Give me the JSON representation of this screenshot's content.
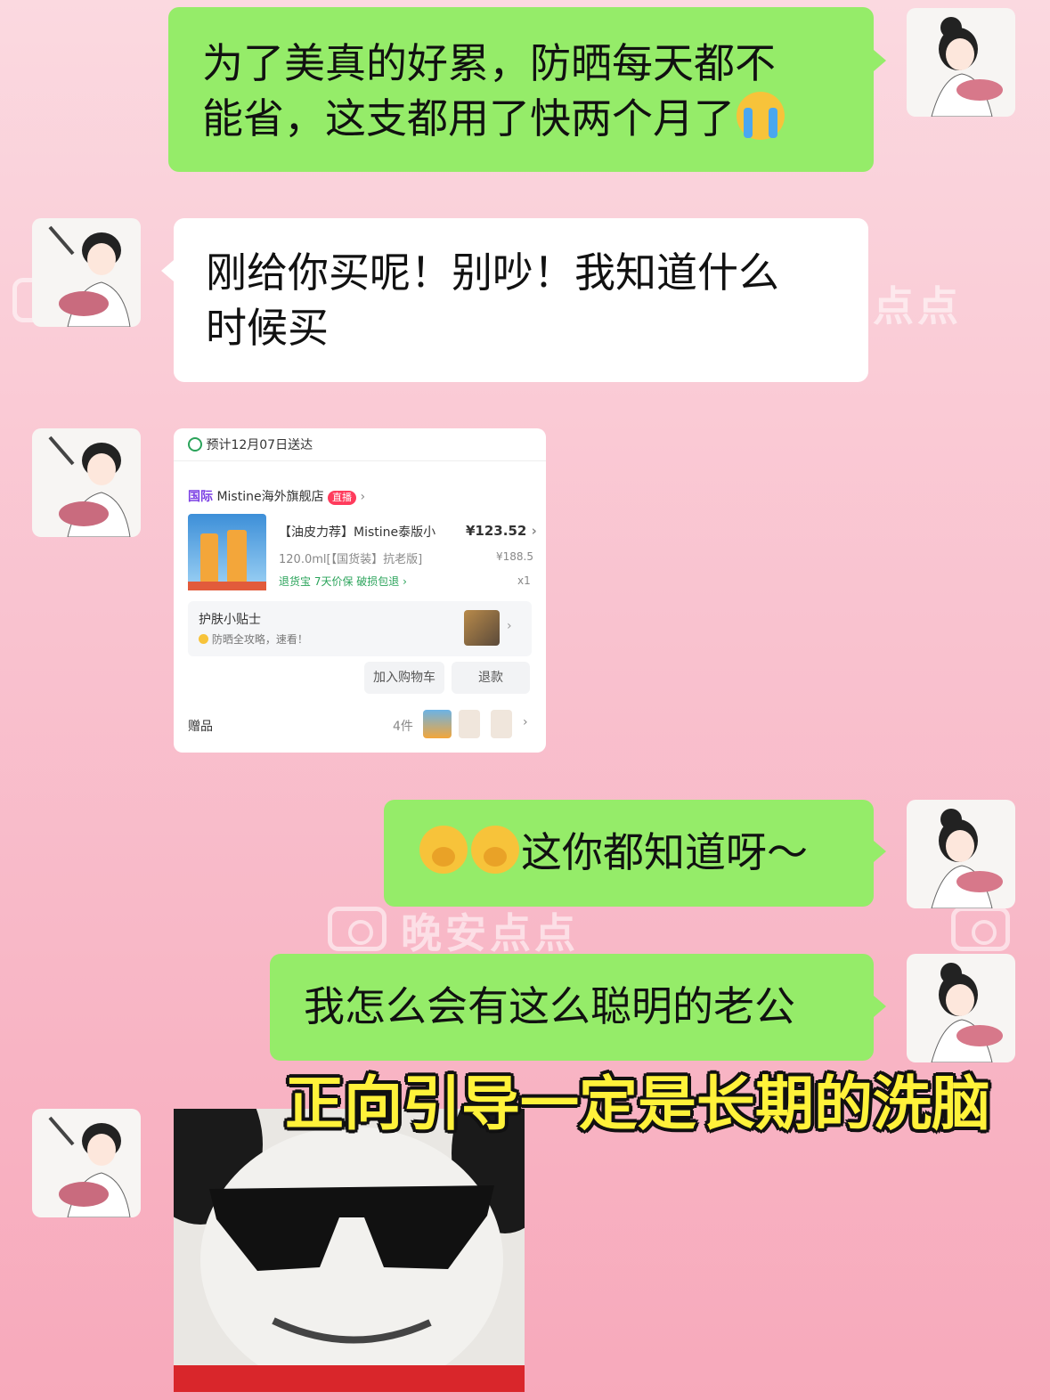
{
  "watermark": {
    "text": "晚安点点"
  },
  "messages": [
    {
      "side": "right",
      "bubble": "green",
      "lines": [
        "为了美真的好累，防晒每天都不",
        "能省，这支都用了快两个月了"
      ],
      "emoji": "crying-face"
    },
    {
      "side": "left",
      "bubble": "white",
      "lines": [
        "刚给你买呢！别吵！我知道什么",
        "时候买"
      ]
    },
    {
      "side": "left",
      "type": "order-card"
    },
    {
      "side": "right",
      "bubble": "green",
      "text": "这你都知道呀～",
      "emoji": "shushing-face"
    },
    {
      "side": "right",
      "bubble": "green",
      "text": "我怎么会有这么聪明的老公"
    },
    {
      "side": "left",
      "type": "sticker",
      "sticker": "panda-sunglasses-meme"
    }
  ],
  "order_card": {
    "delivery": "预计12月07日送达",
    "store_tag": "国际",
    "store_name": "Mistine海外旗舰店",
    "live_badge": "直播",
    "product_title": "【油皮力荐】Mistine泰版小",
    "product_spec": "120.0ml[【国货装】抗老版]",
    "price": "¥123.52",
    "original_price": "¥188.5",
    "quantity": "x1",
    "services": "退货宝  7天价保  破损包退",
    "tips_title": "护肤小贴士",
    "tips_sub": "防晒全攻略，速看！",
    "btn_cart": "加入购物车",
    "btn_refund": "退款",
    "gift_label": "赠品",
    "gift_count": "4件"
  },
  "caption": "正向引导一定是长期的洗脑",
  "colors": {
    "green_bubble": "#95ec69",
    "white_bubble": "#ffffff",
    "caption": "#fff23a",
    "background": "#f9c2cf"
  }
}
